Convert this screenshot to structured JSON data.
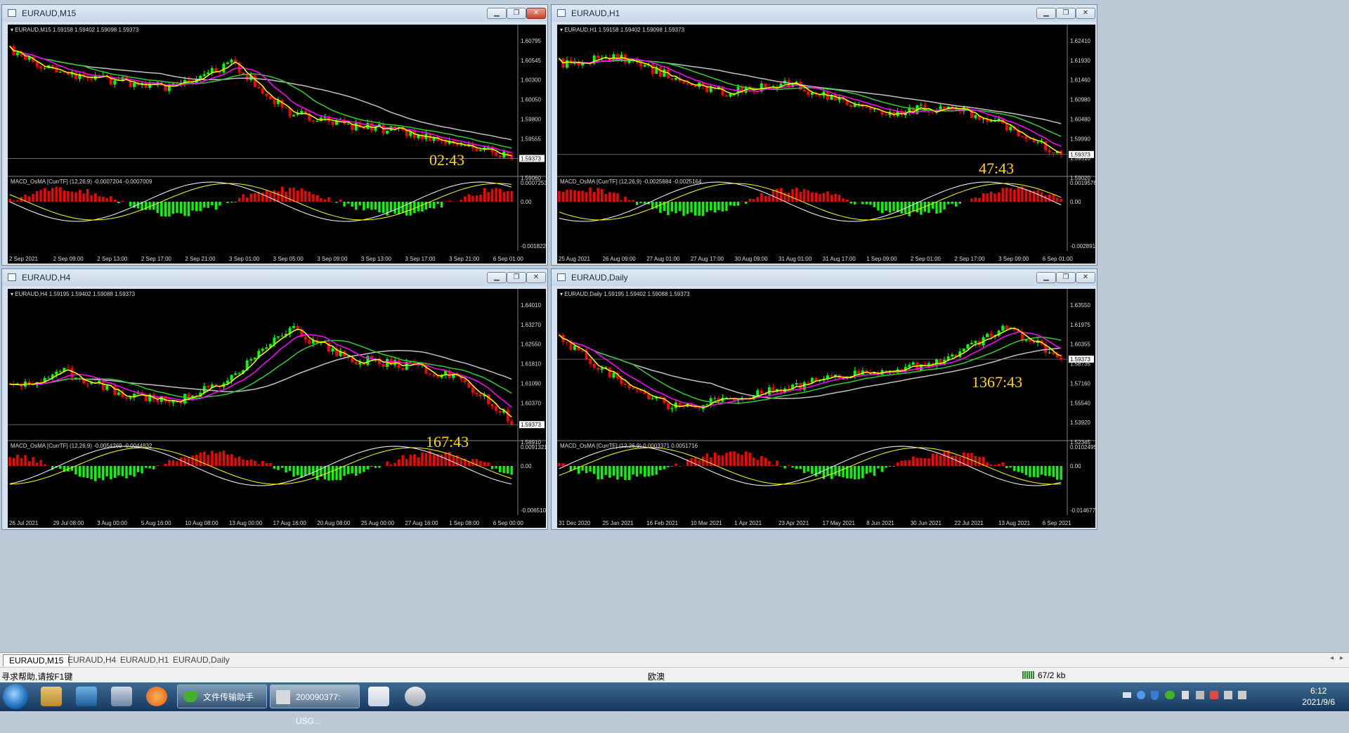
{
  "windows": [
    {
      "id": "m15",
      "title": "EURAUD,M15",
      "ohlc_label": "EURAUD,M15  1.59158 1.59402 1.59098 1.59373",
      "timer": "02:43",
      "price_scale": [
        "1.60795",
        "1.60545",
        "1.60300",
        "1.60050",
        "1.59800",
        "1.59555",
        "1.59305",
        "1.59060"
      ],
      "current_price": "1.59373",
      "macd_label": "MACD_OsMA [CurrTF] (12,26,9) -0.0007204 -0.0007009",
      "macd_scale": [
        "0.0007253",
        "0.00",
        "-0.001822"
      ],
      "time_labels": [
        "2 Sep 2021",
        "2 Sep 09:00",
        "2 Sep 13:00",
        "2 Sep 17:00",
        "2 Sep 21:00",
        "3 Sep 01:00",
        "3 Sep 05:00",
        "3 Sep 09:00",
        "3 Sep 13:00",
        "3 Sep 17:00",
        "3 Sep 21:00",
        "6 Sep 01:00"
      ]
    },
    {
      "id": "h1",
      "title": "EURAUD,H1",
      "ohlc_label": "EURAUD,H1  1.59158 1.59402 1.59098 1.59373",
      "timer": "47:43",
      "price_scale": [
        "1.62410",
        "1.61930",
        "1.61460",
        "1.60980",
        "1.60480",
        "1.59990",
        "1.59510",
        "1.59020"
      ],
      "current_price": "1.59373",
      "macd_label": "MACD_OsMA [CurrTF] (12,26,9) -0.0025884 -0.0025164",
      "macd_scale": [
        "0.0019576",
        "0.00",
        "-0.002891"
      ],
      "time_labels": [
        "25 Aug 2021",
        "26 Aug 09:00",
        "27 Aug 01:00",
        "27 Aug 17:00",
        "30 Aug 09:00",
        "31 Aug 01:00",
        "31 Aug 17:00",
        "1 Sep 09:00",
        "2 Sep 01:00",
        "2 Sep 17:00",
        "3 Sep 09:00",
        "6 Sep 01:00"
      ]
    },
    {
      "id": "h4",
      "title": "EURAUD,H4",
      "ohlc_label": "EURAUD,H4  1.59195 1.59402 1.59088 1.59373",
      "timer": "167:43",
      "price_scale": [
        "1.64010",
        "1.63270",
        "1.62550",
        "1.61810",
        "1.61090",
        "1.60370",
        "1.59630",
        "1.58910"
      ],
      "current_price": "1.59373",
      "macd_label": "MACD_OsMA [CurrTF] (12,26,9) -0.0054269 -0.0044832",
      "macd_scale": [
        "0.0091321",
        "0.00",
        "-0.006510"
      ],
      "time_labels": [
        "26 Jul 2021",
        "29 Jul 08:00",
        "3 Aug 00:00",
        "5 Aug 16:00",
        "10 Aug 08:00",
        "13 Aug 00:00",
        "17 Aug 16:00",
        "20 Aug 08:00",
        "25 Aug 00:00",
        "27 Aug 16:00",
        "1 Sep 08:00",
        "6 Sep 00:00"
      ]
    },
    {
      "id": "d1",
      "title": "EURAUD,Daily",
      "ohlc_label": "EURAUD,Daily  1.59195 1.59402 1.59088 1.59373",
      "timer": "1367:43",
      "price_scale": [
        "1.63550",
        "1.61975",
        "1.60355",
        "1.58735",
        "1.57160",
        "1.55540",
        "1.53920",
        "1.52345"
      ],
      "current_price": "1.59373",
      "macd_label": "MACD_OsMA [CurrTF] (12,26,9) 0.0003371 0.0051716",
      "macd_scale": [
        "0.0102495",
        "0.00",
        "-0.014677"
      ],
      "time_labels": [
        "31 Dec 2020",
        "25 Jan 2021",
        "16 Feb 2021",
        "10 Mar 2021",
        "1 Apr 2021",
        "23 Apr 2021",
        "17 May 2021",
        "8 Jun 2021",
        "30 Jun 2021",
        "22 Jul 2021",
        "13 Aug 2021",
        "6 Sep 2021"
      ]
    }
  ],
  "tabs": [
    "EURAUD,M15",
    "EURAUD,H4",
    "EURAUD,H1",
    "EURAUD,Daily"
  ],
  "active_tab": "EURAUD,M15",
  "status": {
    "help": "寻求帮助,请按F1键",
    "profile": "欧澳",
    "traffic": "67/2 kb"
  },
  "taskbar": {
    "wechat_label": "文件传输助手",
    "mt4_label": "200090377: USG...",
    "time": "6:12",
    "date": "2021/9/6"
  },
  "colors": {
    "bull": "#00ff00",
    "bear": "#ff0000",
    "ma_yellow": "#ffff00",
    "ma_magenta": "#ff00ff",
    "ma_green": "#33cc33",
    "ma_gray": "#c0c0c0",
    "timer": "#ffd700"
  }
}
